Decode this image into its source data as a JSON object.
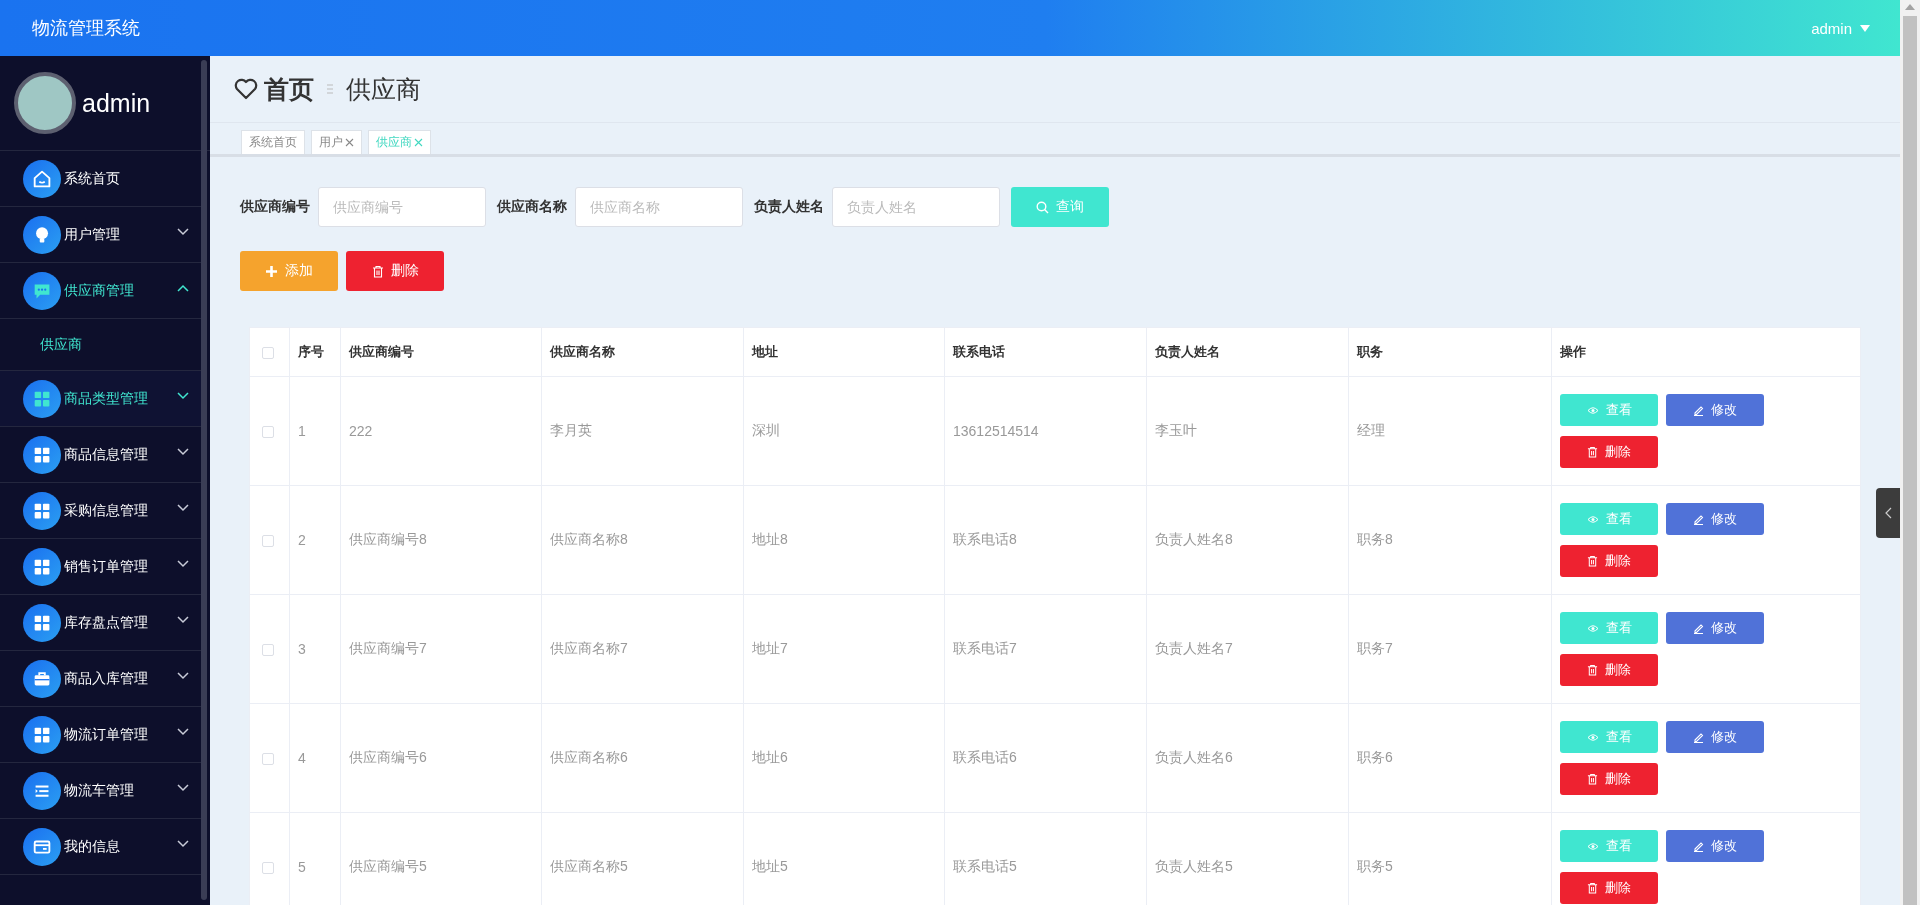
{
  "header": {
    "title": "物流管理系统",
    "user": "admin"
  },
  "sidebar": {
    "user": "admin",
    "items": [
      {
        "kind": "home",
        "label": "系统首页",
        "expandable": false,
        "expanded": false,
        "hovered": false
      },
      {
        "kind": "bulb",
        "label": "用户管理",
        "expandable": true,
        "expanded": false,
        "hovered": false
      },
      {
        "kind": "chat",
        "label": "供应商管理",
        "expandable": true,
        "expanded": true,
        "hovered": false,
        "children": [
          {
            "label": "供应商",
            "selected": true
          }
        ]
      },
      {
        "kind": "grid",
        "label": "商品类型管理",
        "expandable": true,
        "expanded": false,
        "hovered": true
      },
      {
        "kind": "grid",
        "label": "商品信息管理",
        "expandable": true,
        "expanded": false,
        "hovered": false
      },
      {
        "kind": "grid",
        "label": "采购信息管理",
        "expandable": true,
        "expanded": false,
        "hovered": false
      },
      {
        "kind": "grid",
        "label": "销售订单管理",
        "expandable": true,
        "expanded": false,
        "hovered": false
      },
      {
        "kind": "grid",
        "label": "库存盘点管理",
        "expandable": true,
        "expanded": false,
        "hovered": false
      },
      {
        "kind": "briefcase",
        "label": "商品入库管理",
        "expandable": true,
        "expanded": false,
        "hovered": false
      },
      {
        "kind": "grid",
        "label": "物流订单管理",
        "expandable": true,
        "expanded": false,
        "hovered": false
      },
      {
        "kind": "list",
        "label": "物流车管理",
        "expandable": true,
        "expanded": false,
        "hovered": false
      },
      {
        "kind": "card",
        "label": "我的信息",
        "expandable": true,
        "expanded": false,
        "hovered": false
      }
    ]
  },
  "breadcrumb": {
    "home": "首页",
    "current": "供应商"
  },
  "tabs": [
    {
      "label": "系统首页",
      "closable": false,
      "selected": false
    },
    {
      "label": "用户",
      "closable": true,
      "selected": false
    },
    {
      "label": "供应商",
      "closable": true,
      "selected": true
    }
  ],
  "search": {
    "fields": [
      {
        "label": "供应商编号",
        "placeholder": "供应商编号"
      },
      {
        "label": "供应商名称",
        "placeholder": "供应商名称"
      },
      {
        "label": "负责人姓名",
        "placeholder": "负责人姓名"
      }
    ],
    "button": "查询"
  },
  "toolbar": [
    {
      "kind": "add",
      "label": "添加"
    },
    {
      "kind": "delete",
      "label": "删除"
    }
  ],
  "table": {
    "select_all": {
      "checked": false
    },
    "columns": [
      "序号",
      "供应商编号",
      "供应商名称",
      "地址",
      "联系电话",
      "负责人姓名",
      "职务",
      "操作"
    ],
    "rows": [
      {
        "checked": false,
        "cells": [
          "1",
          "222",
          "李月英",
          "深圳",
          "13612514514",
          "李玉叶",
          "经理"
        ],
        "actions": [
          {
            "kind": "view",
            "label": "查看"
          },
          {
            "kind": "edit",
            "label": "修改"
          },
          {
            "kind": "delete",
            "label": "删除"
          }
        ]
      },
      {
        "checked": false,
        "cells": [
          "2",
          "供应商编号8",
          "供应商名称8",
          "地址8",
          "联系电话8",
          "负责人姓名8",
          "职务8"
        ],
        "actions": [
          {
            "kind": "view",
            "label": "查看"
          },
          {
            "kind": "edit",
            "label": "修改"
          },
          {
            "kind": "delete",
            "label": "删除"
          }
        ]
      },
      {
        "checked": false,
        "cells": [
          "3",
          "供应商编号7",
          "供应商名称7",
          "地址7",
          "联系电话7",
          "负责人姓名7",
          "职务7"
        ],
        "actions": [
          {
            "kind": "view",
            "label": "查看"
          },
          {
            "kind": "edit",
            "label": "修改"
          },
          {
            "kind": "delete",
            "label": "删除"
          }
        ]
      },
      {
        "checked": false,
        "cells": [
          "4",
          "供应商编号6",
          "供应商名称6",
          "地址6",
          "联系电话6",
          "负责人姓名6",
          "职务6"
        ],
        "actions": [
          {
            "kind": "view",
            "label": "查看"
          },
          {
            "kind": "edit",
            "label": "修改"
          },
          {
            "kind": "delete",
            "label": "删除"
          }
        ]
      },
      {
        "checked": false,
        "cells": [
          "5",
          "供应商编号5",
          "供应商名称5",
          "地址5",
          "联系电话5",
          "负责人姓名5",
          "职务5"
        ],
        "actions": [
          {
            "kind": "view",
            "label": "查看"
          },
          {
            "kind": "edit",
            "label": "修改"
          },
          {
            "kind": "delete",
            "label": "删除"
          }
        ]
      }
    ]
  }
}
